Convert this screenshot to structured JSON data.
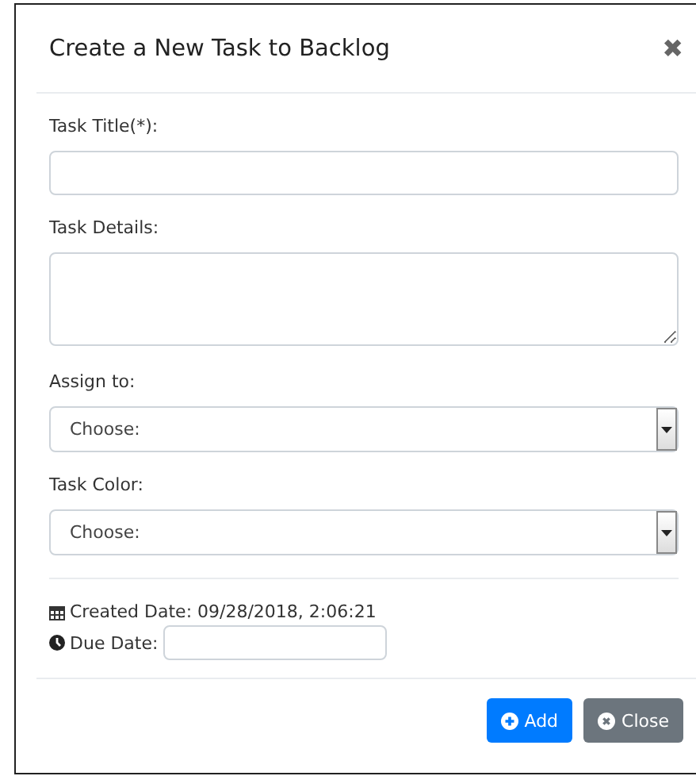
{
  "dialog": {
    "title": "Create a New Task to Backlog",
    "close_icon": "✖"
  },
  "fields": [
    {
      "label": "Task Title(*):",
      "kind": "input"
    },
    {
      "label": "Task Details:",
      "kind": "textarea"
    },
    {
      "label": "Assign to:",
      "kind": "select",
      "value": "Choose:"
    },
    {
      "label": "Task Color:",
      "kind": "select",
      "value": "Choose:"
    }
  ],
  "created_date": "Created Date: 09/28/2018, 2:06:21",
  "due_date": {
    "label": "Due Date:"
  },
  "buttons": [
    {
      "label": "Add",
      "kind": "primary"
    },
    {
      "label": "Close",
      "kind": "secondary"
    }
  ]
}
